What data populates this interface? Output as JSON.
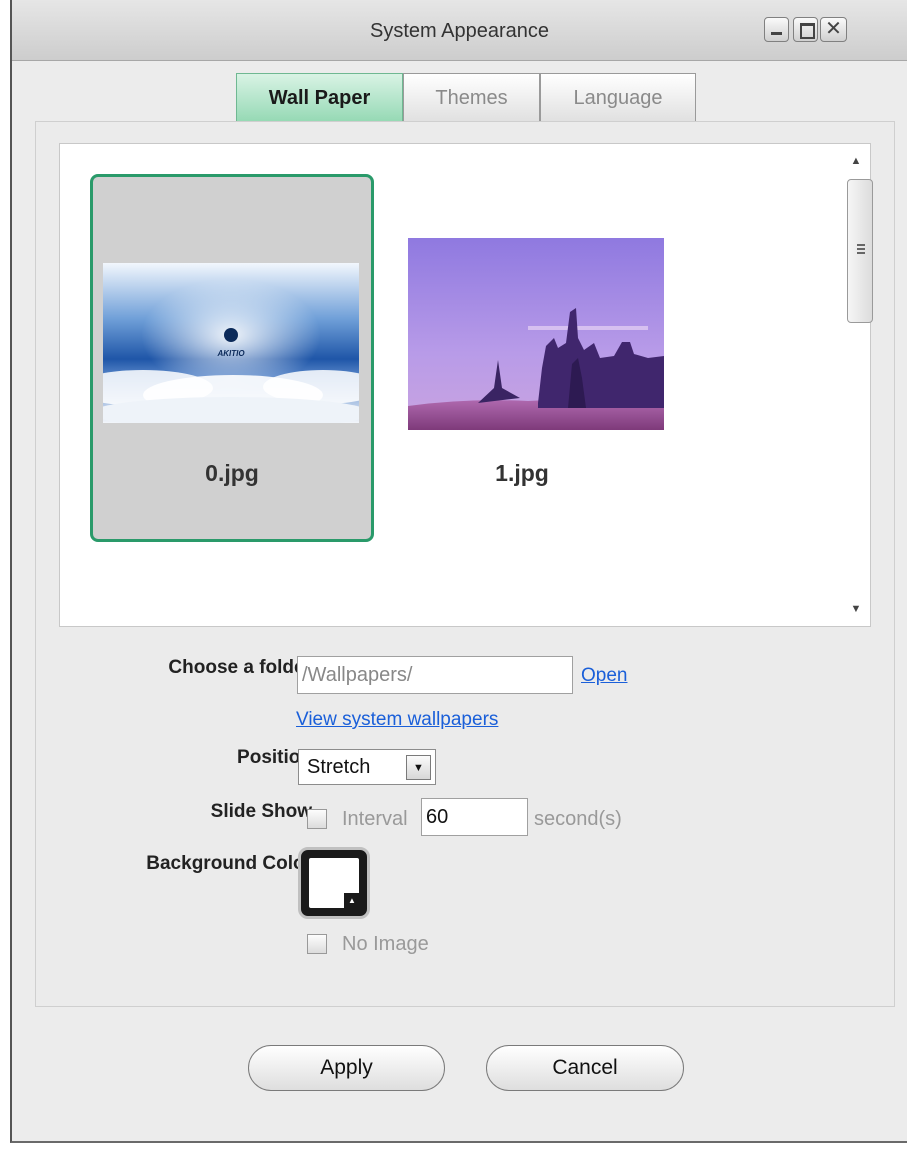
{
  "window": {
    "title": "System Appearance",
    "controls": {
      "minimize": "minimize",
      "maximize": "maximize",
      "close": "✕"
    }
  },
  "tabs": [
    {
      "label": "Wall Paper",
      "active": true
    },
    {
      "label": "Themes",
      "active": false
    },
    {
      "label": "Language",
      "active": false
    }
  ],
  "gallery": {
    "items": [
      {
        "caption": "0.jpg",
        "selected": true,
        "logo_text": "AKITIO"
      },
      {
        "caption": "1.jpg",
        "selected": false
      }
    ],
    "scroll_up": "▲",
    "scroll_down": "▼"
  },
  "form": {
    "folder_label": "Choose a folder",
    "folder_value": "/Wallpapers/",
    "open_link": "Open",
    "view_system_link": "View system wallpapers",
    "position_label": "Position",
    "position_value": "Stretch",
    "position_arrow": "▼",
    "slideshow_label": "Slide Show",
    "slideshow_checked": false,
    "interval_label": "Interval",
    "interval_value": "60",
    "interval_unit": "second(s)",
    "bg_color_label": "Background Color",
    "bg_color_value": "#ffffff",
    "bg_color_corner": "▲",
    "no_image_label": "No Image",
    "no_image_checked": false
  },
  "buttons": {
    "apply": "Apply",
    "cancel": "Cancel"
  },
  "colors": {
    "accent_selected": "#2a9a6a",
    "tab_active": "#95d9b4",
    "link": "#1a5fd9"
  }
}
